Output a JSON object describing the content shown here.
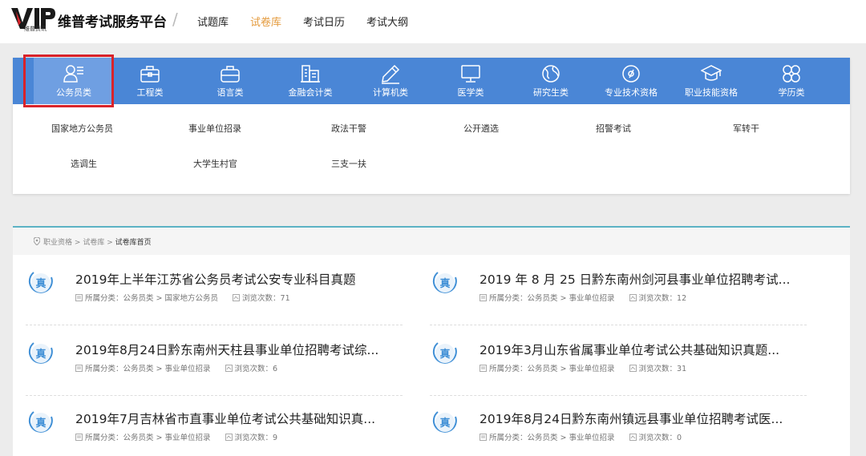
{
  "header": {
    "logo_text": "VIP",
    "logo_sub": "维普资讯",
    "brand": "维普考试服务平台",
    "nav": [
      {
        "label": "试题库",
        "active": false
      },
      {
        "label": "试卷库",
        "active": true
      },
      {
        "label": "考试日历",
        "active": false
      },
      {
        "label": "考试大纲",
        "active": false
      }
    ]
  },
  "categories": [
    {
      "label": "公务员类",
      "icon": "civil-servant-icon",
      "selected": true
    },
    {
      "label": "工程类",
      "icon": "toolbox-icon",
      "selected": false
    },
    {
      "label": "语言类",
      "icon": "briefcase-icon",
      "selected": false
    },
    {
      "label": "金融会计类",
      "icon": "finance-building-icon",
      "selected": false
    },
    {
      "label": "计算机类",
      "icon": "pen-icon",
      "selected": false
    },
    {
      "label": "医学类",
      "icon": "monitor-icon",
      "selected": false
    },
    {
      "label": "研究生类",
      "icon": "globe-icon",
      "selected": false
    },
    {
      "label": "专业技术资格",
      "icon": "at-sign-icon",
      "selected": false
    },
    {
      "label": "职业技能资格",
      "icon": "graduation-cap-icon",
      "selected": false
    },
    {
      "label": "学历类",
      "icon": "grid-circles-icon",
      "selected": false
    }
  ],
  "subcategories": [
    "国家地方公务员",
    "事业单位招录",
    "政法干警",
    "公开遴选",
    "招警考试",
    "军转干",
    "选调生",
    "大学生村官",
    "三支一扶"
  ],
  "breadcrumb": {
    "items": [
      "职业资格",
      "试卷库"
    ],
    "current": "试卷库首页",
    "separator": ">"
  },
  "papers": [
    {
      "badge": "真",
      "title": "2019年上半年江苏省公务员考试公安专业科目真题",
      "category_label": "所属分类：",
      "category": "公务员类 > 国家地方公务员",
      "views_label": "浏览次数：",
      "views": "71"
    },
    {
      "badge": "真",
      "title": "2019 年 8 月 25 日黔东南州剑河县事业单位招聘考试...",
      "category_label": "所属分类：",
      "category": "公务员类 > 事业单位招录",
      "views_label": "浏览次数：",
      "views": "12"
    },
    {
      "badge": "真",
      "title": "2019年8月24日黔东南州天柱县事业单位招聘考试综...",
      "category_label": "所属分类：",
      "category": "公务员类 > 事业单位招录",
      "views_label": "浏览次数：",
      "views": "6"
    },
    {
      "badge": "真",
      "title": "2019年3月山东省属事业单位考试公共基础知识真题...",
      "category_label": "所属分类：",
      "category": "公务员类 > 事业单位招录",
      "views_label": "浏览次数：",
      "views": "31"
    },
    {
      "badge": "真",
      "title": "2019年7月吉林省市直事业单位考试公共基础知识真...",
      "category_label": "所属分类：",
      "category": "公务员类 > 事业单位招录",
      "views_label": "浏览次数：",
      "views": "9"
    },
    {
      "badge": "真",
      "title": "2019年8月24日黔东南州镇远县事业单位招聘考试医...",
      "category_label": "所属分类：",
      "category": "公务员类 > 事业单位招录",
      "views_label": "浏览次数：",
      "views": "0"
    }
  ],
  "colors": {
    "category_bar": "#4a86d6",
    "nav_active": "#e49a3c",
    "highlight_box": "#d9232a",
    "badge_blue": "#3f8fd6"
  }
}
